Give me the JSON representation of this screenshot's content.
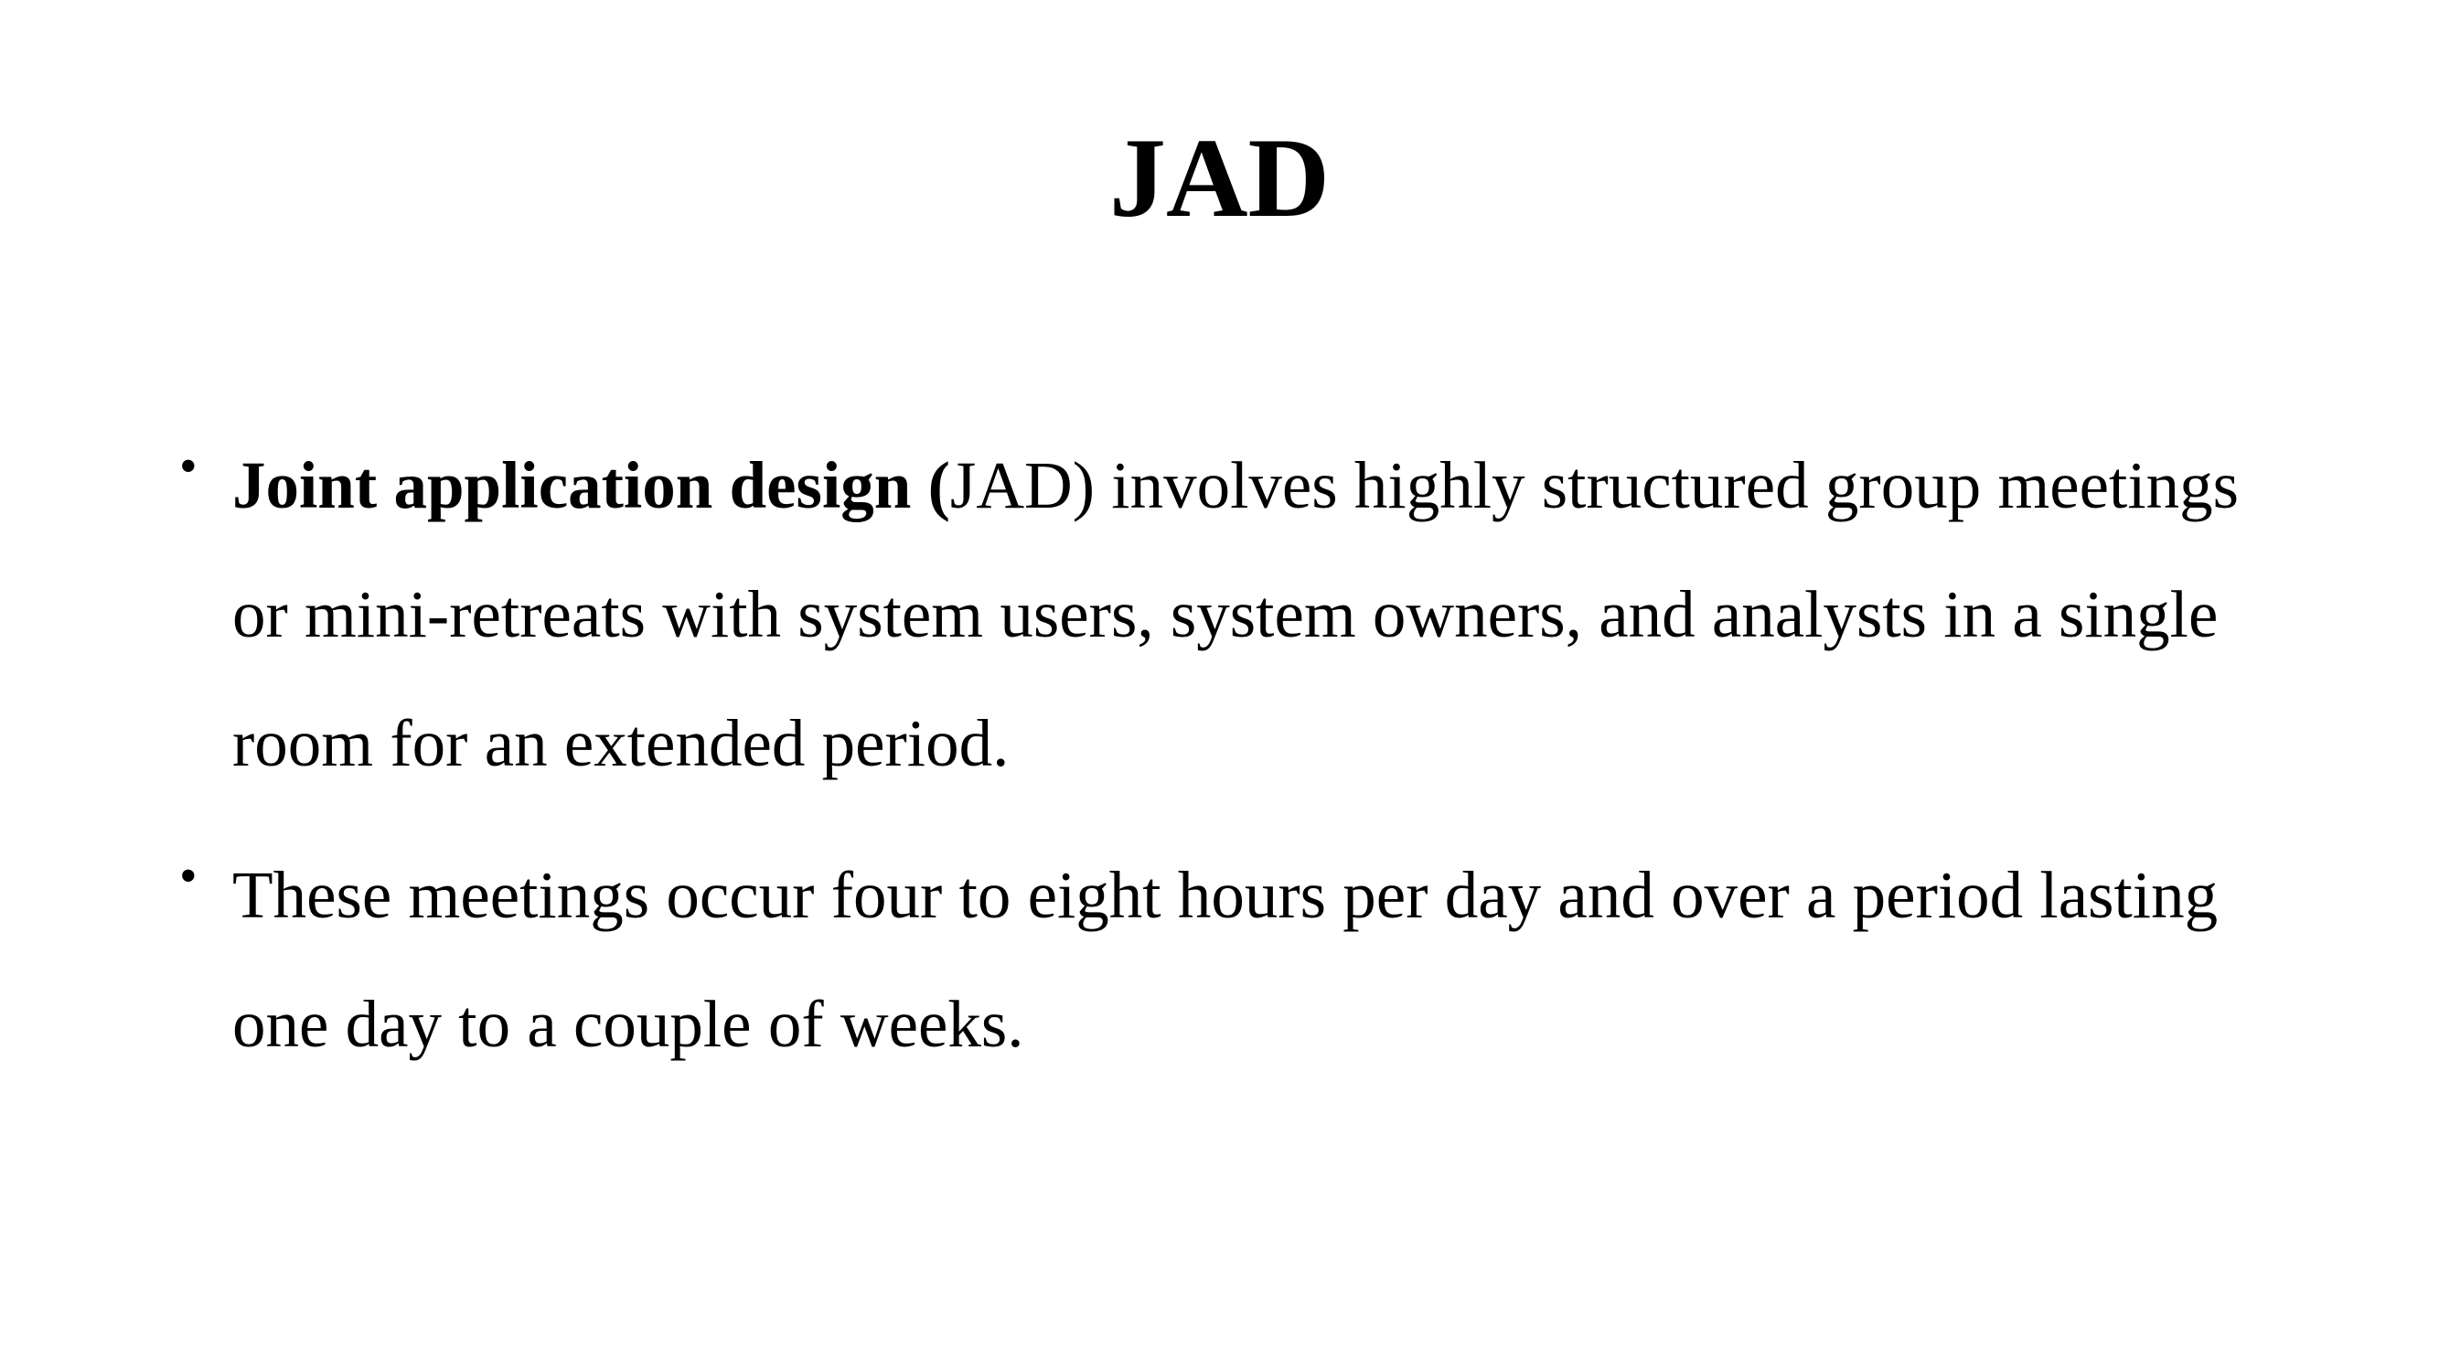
{
  "slide": {
    "title": "JAD",
    "bullets": [
      {
        "bold_prefix": "Joint application design (",
        "text": "JAD) involves highly structured group meetings or mini-retreats with system users, system owners, and analysts in a single room for an extended period."
      },
      {
        "text": "These meetings occur four to eight hours per day and over a period lasting one day to a couple of weeks."
      }
    ],
    "bullet_glyph": "•"
  }
}
